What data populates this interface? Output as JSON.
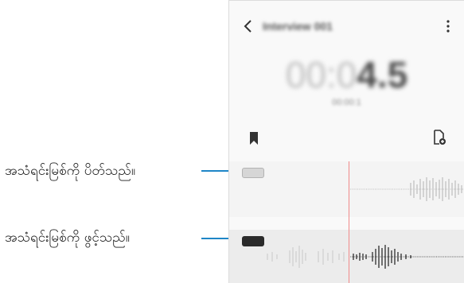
{
  "callouts": [
    {
      "label": "အသံရင်းမြစ်ကို ပိတ်သည်။"
    },
    {
      "label": "အသံရင်းမြစ်ကို ဖွင့်သည်။"
    }
  ],
  "app": {
    "title": "Interview 001",
    "timer_dim": "00:0",
    "timer_bold": "4.5",
    "sub_timer": "00:00:1"
  },
  "icons": {
    "back": "back-arrow-icon",
    "more": "more-vertical-icon",
    "bookmark": "bookmark-icon",
    "add_file": "add-file-icon"
  },
  "colors": {
    "callout_line": "#1e86c7",
    "playhead": "#f08a8a",
    "chip_active": "#2a2a2a",
    "chip_muted": "#d6d6d6"
  }
}
